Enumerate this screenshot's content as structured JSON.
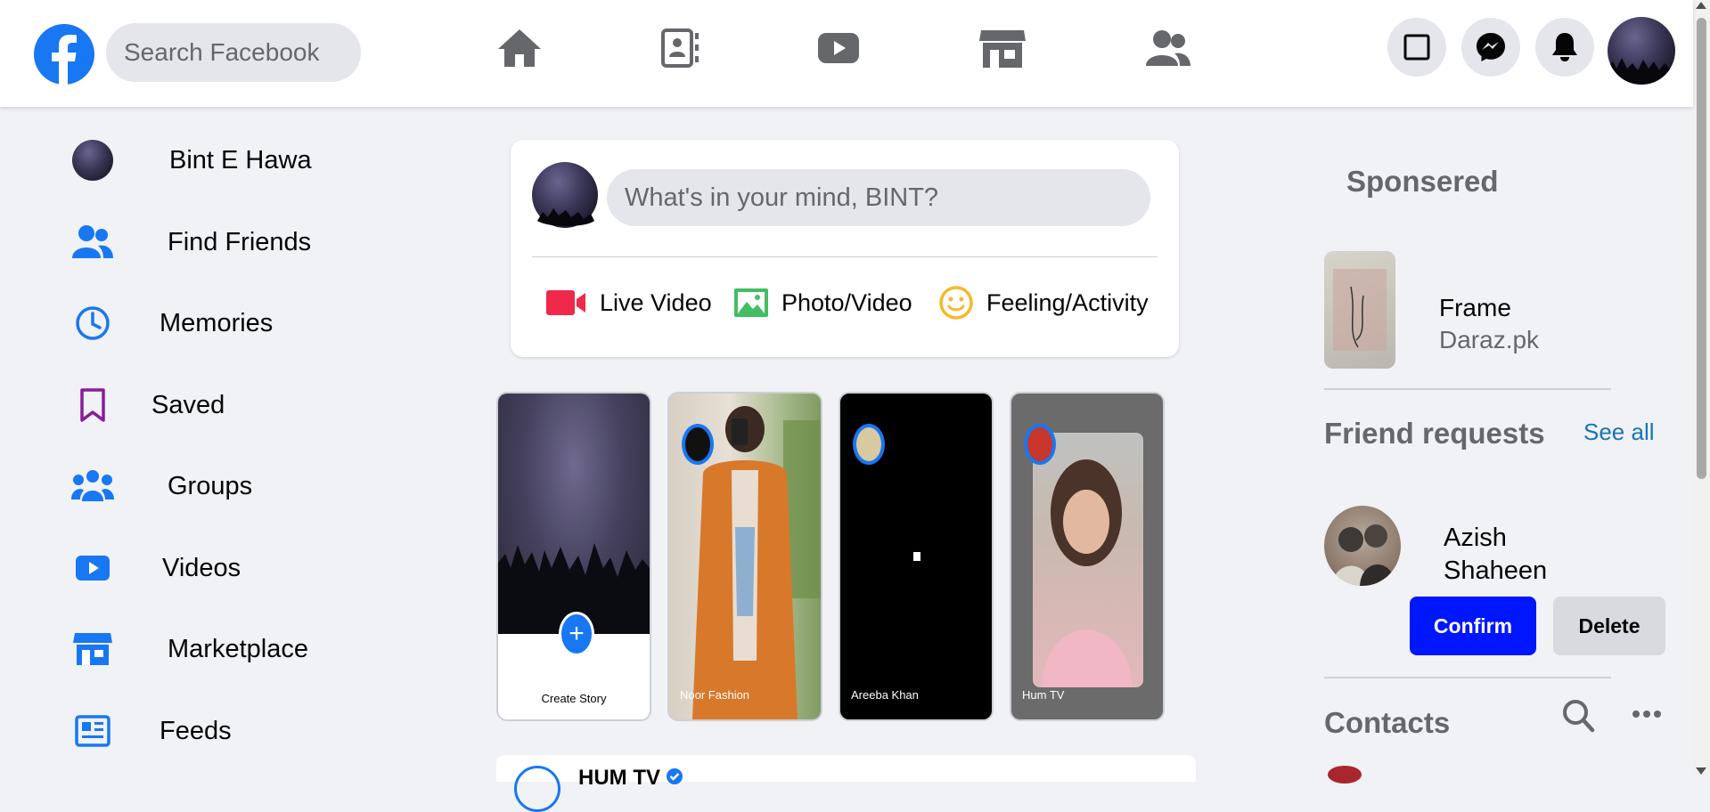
{
  "topbar": {
    "search_placeholder": "Search Facebook",
    "nav": [
      "home-icon",
      "contact-card-icon",
      "video-icon",
      "marketplace-icon",
      "groups-icon"
    ],
    "actions": [
      "square-icon",
      "messenger-icon",
      "bell-icon"
    ],
    "accent": "#1877f2"
  },
  "sidebar": {
    "items": [
      {
        "label": "Bint E Hawa",
        "icon": "avatar"
      },
      {
        "label": "Find Friends",
        "icon": "friends-icon"
      },
      {
        "label": "Memories",
        "icon": "clock-icon"
      },
      {
        "label": "Saved",
        "icon": "bookmark-icon"
      },
      {
        "label": "Groups",
        "icon": "groups-icon"
      },
      {
        "label": "Videos",
        "icon": "video-icon"
      },
      {
        "label": "Marketplace",
        "icon": "marketplace-icon"
      },
      {
        "label": "Feeds",
        "icon": "feeds-icon"
      }
    ]
  },
  "composer": {
    "placeholder": "What's in your mind, BINT?",
    "actions": [
      {
        "label": "Live Video",
        "icon": "live-video-icon",
        "color": "#f02849"
      },
      {
        "label": "Photo/Video",
        "icon": "photo-icon",
        "color": "#45bd62"
      },
      {
        "label": "Feeling/Activity",
        "icon": "smiley-icon",
        "color": "#f7b928"
      }
    ]
  },
  "stories": [
    {
      "label": "Create Story"
    },
    {
      "label": "Noor Fashion"
    },
    {
      "label": "Areeba Khan"
    },
    {
      "label": "Hum TV"
    }
  ],
  "post": {
    "author": "HUM TV"
  },
  "right": {
    "sponsored": {
      "heading": "Sponsered",
      "ad_title": "Frame",
      "ad_site": "Daraz.pk"
    },
    "friend_requests": {
      "heading": "Friend requests",
      "see_all": "See all",
      "name_line1": "Azish",
      "name_line2": "Shaheen",
      "confirm": "Confirm",
      "delete": "Delete"
    },
    "contacts": {
      "heading": "Contacts"
    }
  }
}
